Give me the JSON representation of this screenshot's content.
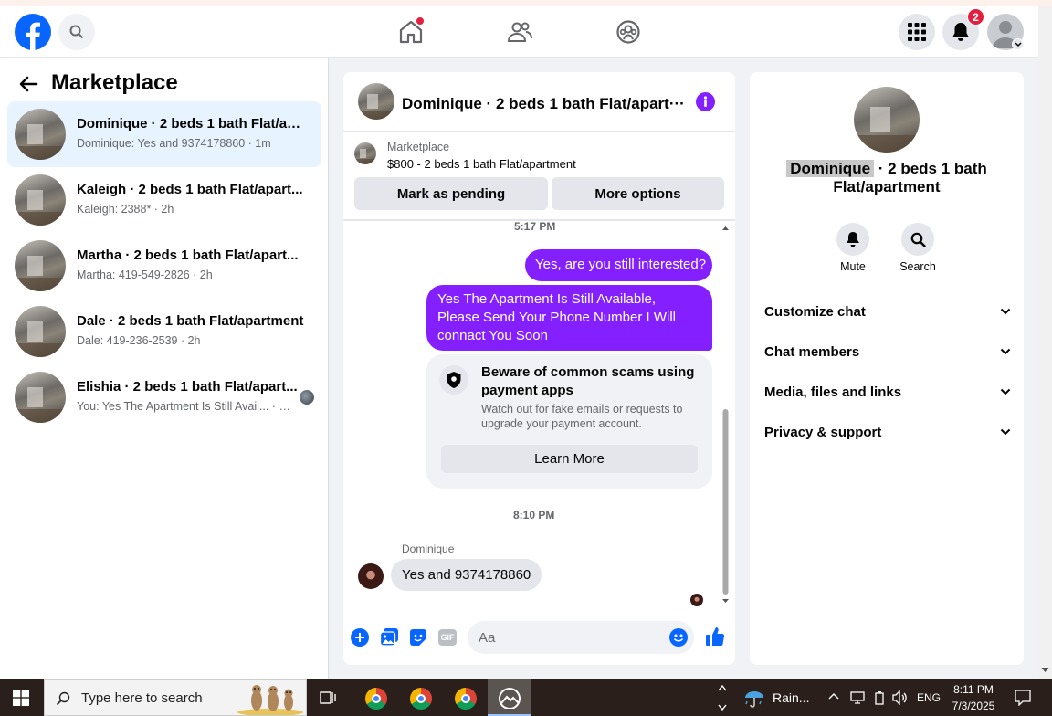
{
  "header": {
    "logo": "facebook-logo",
    "notification_count": "2",
    "nav_icons": [
      "home-icon",
      "friends-icon",
      "groups-icon"
    ]
  },
  "sidebar": {
    "title": "Marketplace",
    "conversations": [
      {
        "title": "Dominique · 2 beds 1 bath Flat/ap...",
        "subtitle": "Dominique: Yes and 9374178860 · 1m",
        "active": true
      },
      {
        "title": "Kaleigh · 2 beds 1 bath Flat/apart...",
        "subtitle": "Kaleigh: 2388* · 2h",
        "active": false
      },
      {
        "title": "Martha · 2 beds 1 bath Flat/apart...",
        "subtitle": "Martha: 419-549-2826 · 2h",
        "active": false
      },
      {
        "title": "Dale · 2 beds 1 bath Flat/apartment",
        "subtitle": "Dale: 419-236-2539 · 2h",
        "active": false
      },
      {
        "title": "Elishia · 2 beds 1 bath Flat/apart...",
        "subtitle": "You: Yes The Apartment Is Still Avail... · 2h",
        "active": false
      }
    ]
  },
  "chat": {
    "title": "Dominique · 2 beds 1 bath Flat/apart···",
    "listing_source": "Marketplace",
    "listing_name": "$800 - 2 beds 1 bath Flat/apartment",
    "mark_pending": "Mark as pending",
    "more_options": "More options",
    "time1": "5:17 PM",
    "msg_out1": "Yes, are you still interested?",
    "msg_out2": "Yes The Apartment Is Still Available, Please Send Your Phone Number I Will connact You Soon",
    "warning_title": "Beware of common scams using payment apps",
    "warning_body": "Watch out for fake emails or requests to upgrade your payment account.",
    "learn_more": "Learn More",
    "time2": "8:10 PM",
    "sender_name": "Dominique",
    "msg_in": "Yes and 9374178860",
    "composer_placeholder": "Aa",
    "brand_purple": "#8420ff",
    "brand_blue": "#0866ff"
  },
  "info": {
    "name_highlight": "Dominique",
    "name_rest": " · 2 beds 1 bath",
    "name_line2": "Flat/apartment",
    "mute_label": "Mute",
    "search_label": "Search",
    "sections": [
      "Customize chat",
      "Chat members",
      "Media, files and links",
      "Privacy & support"
    ]
  },
  "taskbar": {
    "search_placeholder": "Type here to search",
    "weather": "Rain...",
    "language": "ENG",
    "time": "8:11 PM",
    "date": "7/3/2025"
  }
}
